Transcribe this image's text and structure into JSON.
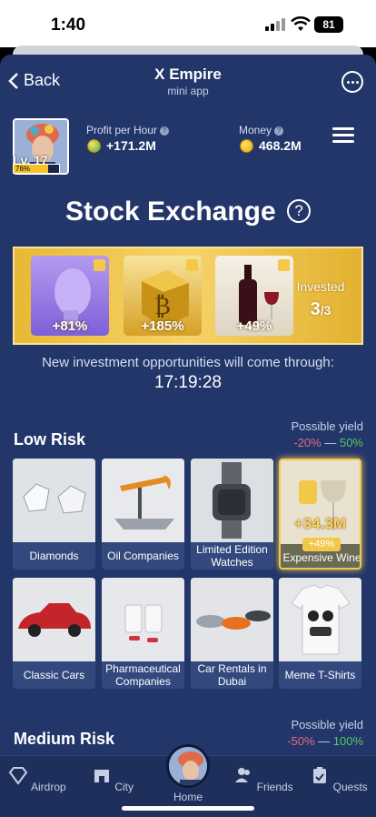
{
  "status": {
    "time": "1:40",
    "battery": "81"
  },
  "nav": {
    "back_label": "Back",
    "title": "X Empire",
    "subtitle": "mini app"
  },
  "profile": {
    "level": "Lv. 17",
    "progress_text": "76%",
    "progress": 0.76
  },
  "stats": {
    "profit_label": "Profit per Hour",
    "profit_value": "+171.2M",
    "money_label": "Money",
    "money_value": "468.2M"
  },
  "page": {
    "title": "Stock Exchange",
    "help": "?"
  },
  "invested": {
    "cards": [
      {
        "pct": "+81%",
        "name": "head"
      },
      {
        "pct": "+185%",
        "name": "crypto-cube"
      },
      {
        "pct": "+49%",
        "name": "wine"
      }
    ],
    "label": "Invested",
    "count": "3",
    "total": "/3"
  },
  "notice": {
    "text": "New investment opportunities will come through:",
    "timer": "17:19:28"
  },
  "low_risk": {
    "title": "Low Risk",
    "yield_label": "Possible yield",
    "yield_min": "-20%",
    "yield_sep": " — ",
    "yield_max": "50%",
    "items": [
      {
        "label": "Diamonds"
      },
      {
        "label": "Oil Companies"
      },
      {
        "label": "Limited Edition Watches"
      },
      {
        "label": "Expensive Wine",
        "value": "+34.3M",
        "pct": "+49%"
      },
      {
        "label": "Classic Cars"
      },
      {
        "label": "Pharmaceutical Companies"
      },
      {
        "label": "Car Rentals in Dubai"
      },
      {
        "label": "Meme T-Shirts"
      }
    ]
  },
  "medium_risk": {
    "title": "Medium Risk",
    "yield_label": "Possible yield",
    "yield_min": "-50%",
    "yield_sep": " — ",
    "yield_max": "100%"
  },
  "tabs": {
    "airdrop": "Airdrop",
    "city": "City",
    "home": "Home",
    "friends": "Friends",
    "quests": "Quests"
  },
  "colors": {
    "background": "#23366a",
    "gold": "#f2c84b",
    "negative": "#e36a7b",
    "positive": "#55c85d"
  }
}
